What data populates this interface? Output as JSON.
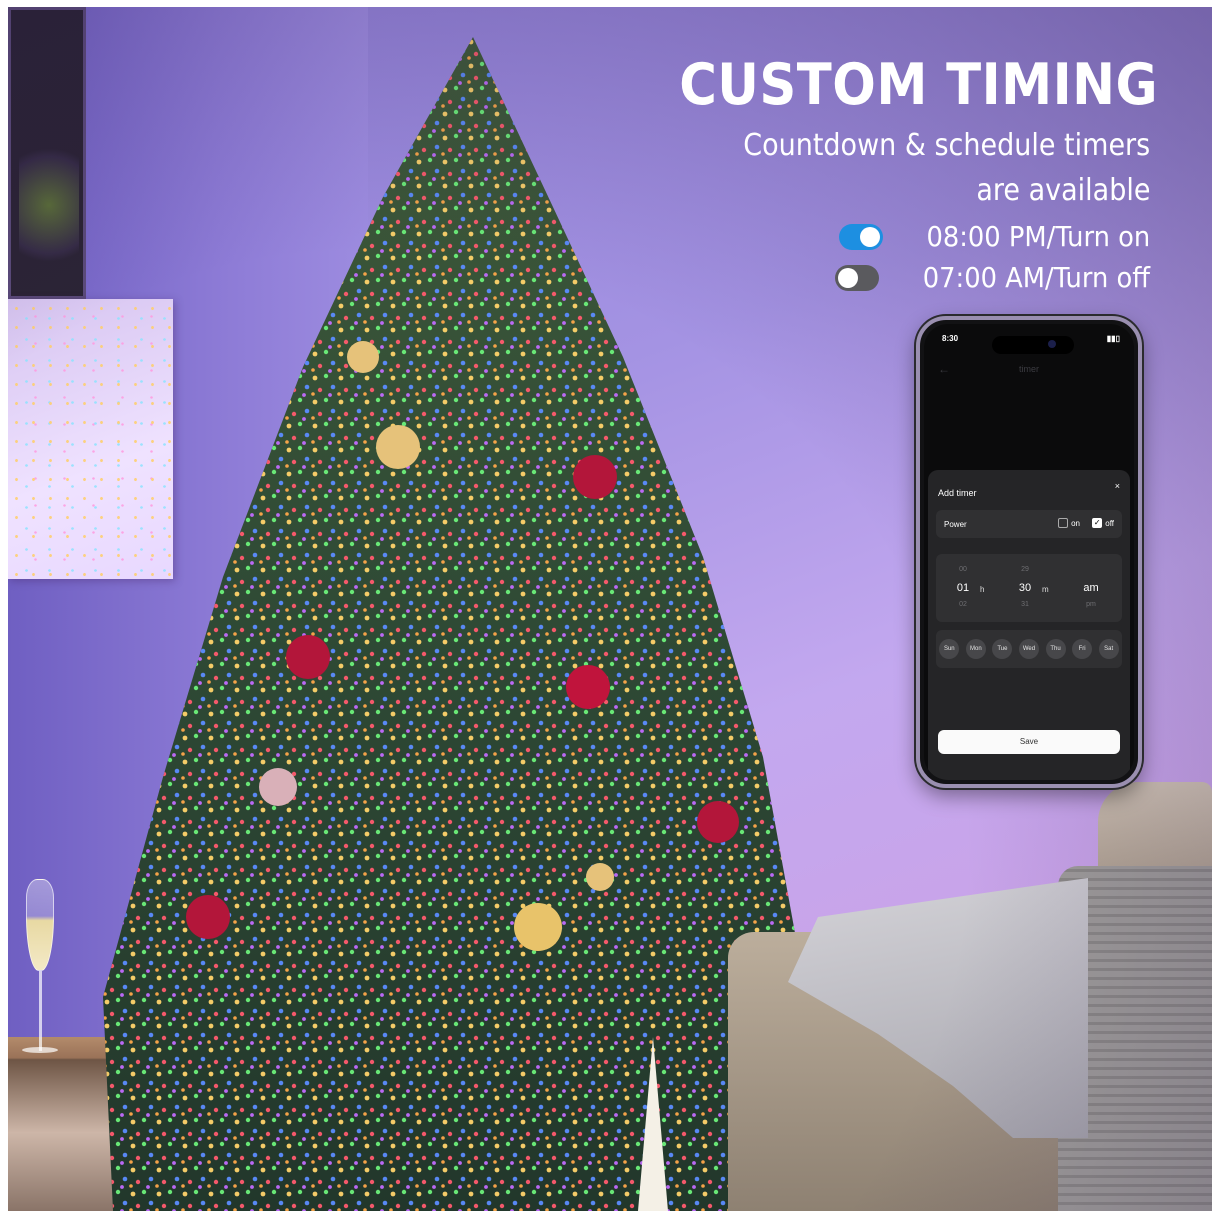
{
  "headline": "CUSTOM TIMING",
  "subtitle_line1": "Countdown & schedule timers",
  "subtitle_line2": "are available",
  "timers": [
    {
      "label": "08:00 PM/Turn on",
      "enabled": true,
      "toggle_color": "#1d8fe1"
    },
    {
      "label": "07:00 AM/Turn off",
      "enabled": false,
      "toggle_color": "#5a5a5e"
    }
  ],
  "phone": {
    "status_time": "8:30",
    "page_title": "timer",
    "sheet": {
      "title": "Add timer",
      "close_glyph": "×",
      "power_label": "Power",
      "option_on": "on",
      "option_off": "off",
      "option_on_checked": false,
      "option_off_checked": true,
      "hour": {
        "prev": "00",
        "current": "01",
        "next": "02",
        "unit": "h"
      },
      "minute": {
        "prev": "29",
        "current": "30",
        "next": "31",
        "unit": "m"
      },
      "meridiem": {
        "current": "am",
        "next": "pm"
      },
      "days": [
        "Sun",
        "Mon",
        "Tue",
        "Wed",
        "Thu",
        "Fri",
        "Sat"
      ],
      "save_label": "Save"
    }
  },
  "colors": {
    "accent_blue": "#1d8fe1",
    "wall_purple": "#a493e3",
    "phone_dark": "#0b0b0c"
  }
}
